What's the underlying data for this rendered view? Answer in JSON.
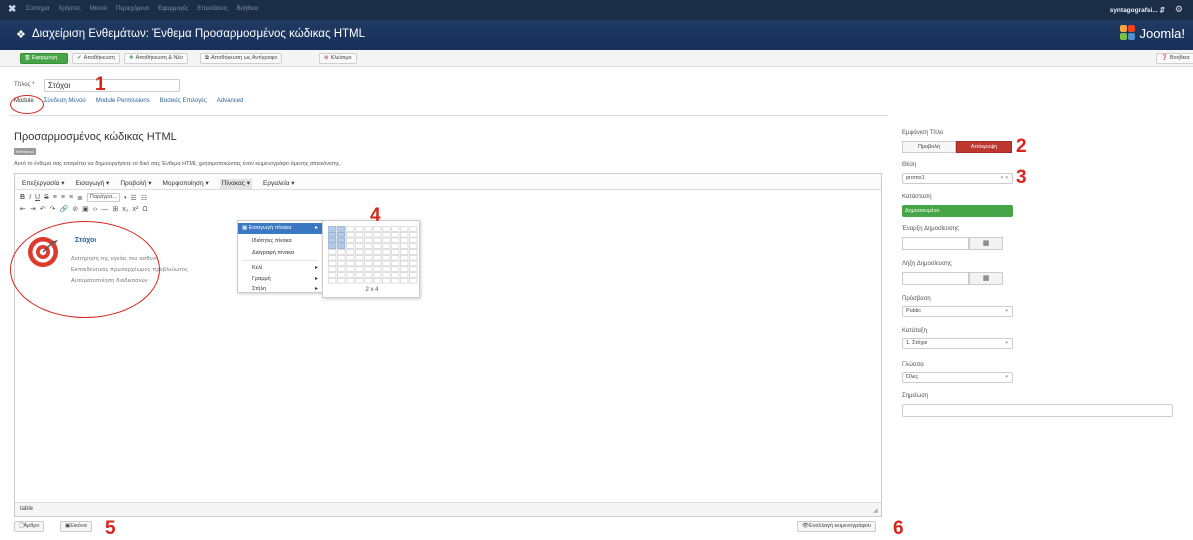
{
  "topnav": {
    "logo": "✖",
    "menu": [
      "Σύστημα",
      "Χρήστες",
      "Μενού",
      "Περιεχόμενο",
      "Εφαρμογές",
      "Επεκτάσεις",
      "Βοήθεια"
    ],
    "user": "syntagografsi... ⇵"
  },
  "header": {
    "title": "Διαχείριση Ενθεμάτων: Ένθεμα Προσαρμοσμένος κώδικας HTML",
    "brand": "Joomla!"
  },
  "toolbar": {
    "apply": "Εφαρμογή",
    "save": "Αποθήκευση",
    "save_new": "Αποθήκευση & Νέο",
    "save_copy": "Αποθήκευση ως Αντίγραφο",
    "close": "Κλείσιμο",
    "help": "Βοήθεια"
  },
  "form": {
    "title_label": "Τίτλος *",
    "title_value": "Στόχοι"
  },
  "tabs": [
    "Module",
    "Σύνδεση Μενού",
    "Module Permissions",
    "Βασικές Επιλογές",
    "Advanced"
  ],
  "module": {
    "heading": "Προσαρμοσμένος κώδικας HTML",
    "badge": "Ιστότοπος",
    "description": "Αυτό το ένθεμα σας επιτρέπει να δημιουργήσετε το δικό σας Ένθεμα HTML χρησιμοποιώντας έναν κειμενογράφο άμεσης απεικόνισης."
  },
  "editor": {
    "menu": [
      "Επεξεργασία ▾",
      "Εισαγωγή ▾",
      "Προβολή ▾",
      "Μορφοποίηση ▾",
      "Πίνακας ▾",
      "Εργαλεία ▾"
    ],
    "format_select": "Παράγρα...",
    "content_title": "Στόχοι",
    "content_lines": [
      "Διατήρηση της υγείας του ασθενή",
      "Εκπαιδευτικός πρωταρχέωμος προβλεύωτος",
      "Αυτοματοποίηση διαδικασιών"
    ],
    "status_path": "table",
    "table_menu": {
      "items": [
        "Εισαγωγή πίνακα",
        "Ιδιότητες πίνακα",
        "Διαγραφή πίνακα",
        "Κελί",
        "Γραμμή",
        "Στήλη"
      ]
    },
    "grid_size": "2 x 4"
  },
  "sidebar": {
    "show_title_label": "Εμφάνιση Τίτλο",
    "show": "Προβολή",
    "hide": "Απόκρυψη",
    "position_label": "Θέση",
    "position_value": "promo1",
    "state_label": "Κατάσταση",
    "state_value": "Δημοσιευμένο",
    "publish_up_label": "Έναρξη Δημοσίευσης",
    "publish_down_label": "Λήξη Δημοσίευσης",
    "access_label": "Πρόσβαση",
    "access_value": "Public",
    "ordering_label": "Κατάταξη",
    "ordering_value": "1. Στόχοι",
    "language_label": "Γλώσσα",
    "language_value": "Όλες",
    "note_label": "Σημείωση"
  },
  "bottom": {
    "article": "Άρθρο",
    "image": "Εικόνα",
    "toggle_editor": "Εναλλαγή κειμενογράφου"
  },
  "annotations": [
    "1",
    "2",
    "3",
    "4",
    "5",
    "6"
  ],
  "colors": {
    "nav_bg": "#1c2e47",
    "header_bg": "#1f3a63",
    "apply_green": "#46a546",
    "hide_red": "#bd362f",
    "state_green": "#46a546",
    "annotation_red": "#d9251c",
    "highlight_blue": "#3a78c3"
  }
}
